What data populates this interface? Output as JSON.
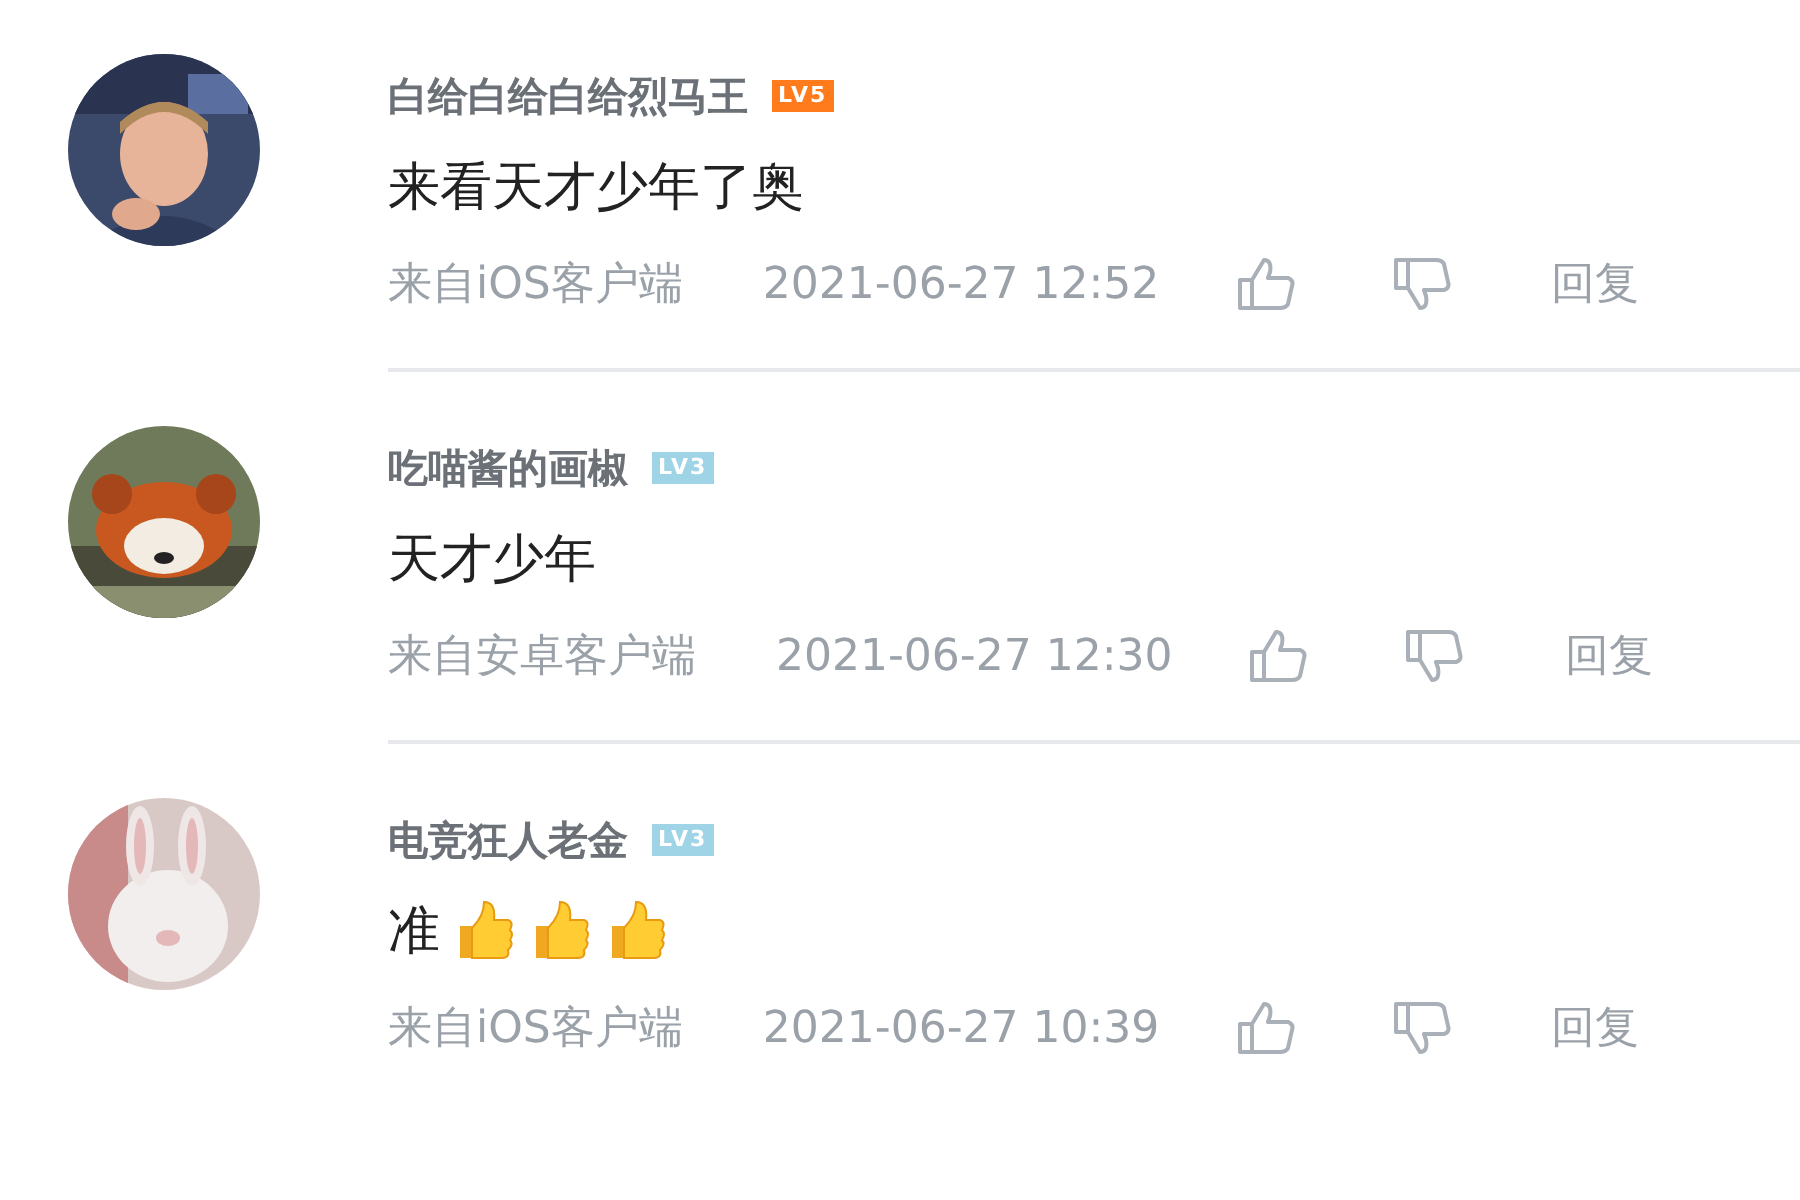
{
  "comments": [
    {
      "username": "白给白给白给烈马王",
      "level_badge": "LV5",
      "color": "#ff7b1c",
      "content": "来看天才少年了奥",
      "source": "来自iOS客户端",
      "time": "2021-06-27 12:52",
      "reply": "回复"
    },
    {
      "username": "吃喵酱的画椒",
      "level_badge": "LV3",
      "color": "#9fd4e6",
      "content": "天才少年",
      "source": "来自安卓客户端",
      "time": "2021-06-27 12:30",
      "reply": "回复"
    },
    {
      "username": "电竞狂人老金",
      "level_badge": "LV3",
      "color": "#9fd4e6",
      "content": "准",
      "emojis": [
        {
          "kind": "thumbs-up"
        },
        {
          "kind": "thumbs-up"
        },
        {
          "kind": "thumbs-up"
        }
      ],
      "source": "来自iOS客户端",
      "time": "2021-06-27 10:39",
      "reply": "回复"
    }
  ]
}
